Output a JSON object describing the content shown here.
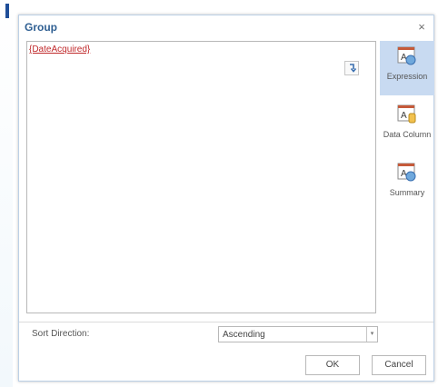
{
  "dialog": {
    "title": "Group",
    "close_icon": "close-icon",
    "close_glyph": "×"
  },
  "editor": {
    "expression": "{DateAcquired}",
    "insert_icon": "insert-arrow-icon"
  },
  "side_panel": {
    "items": [
      {
        "label": "Expression",
        "icon": "expression-icon",
        "active": true
      },
      {
        "label": "Data Column",
        "icon": "data-column-icon",
        "active": false
      },
      {
        "label": "Summary",
        "icon": "summary-icon",
        "active": false
      }
    ]
  },
  "sort": {
    "label": "Sort Direction:",
    "value": "Ascending",
    "arrow_glyph": "▾"
  },
  "buttons": {
    "ok": "OK",
    "cancel": "Cancel"
  },
  "colors": {
    "title": "#2f5f92",
    "accent_active": "#c8daf1",
    "expression_text": "#c0292b"
  }
}
